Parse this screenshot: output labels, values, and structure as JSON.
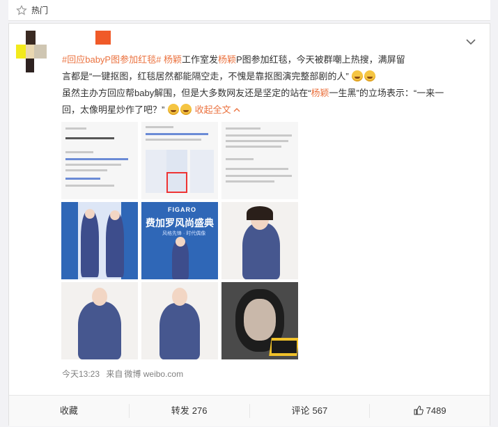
{
  "header": {
    "title": "热门",
    "icon": "star-icon"
  },
  "post": {
    "line1_prefix": "#",
    "line1_hashtag": "回应babyP图参加红毯",
    "line1_hashtag_end": "#",
    "line1_name": "杨颖",
    "line1_text_a": "工作室发",
    "line1_name2": "杨颖",
    "line1_text_b": "P图参加红毯，今天被群嘲上热搜，满屏留",
    "line2_text": "言都是“一键抠图，红毯居然都能隔空走，不愧是靠抠图演完整部剧的人”",
    "line3_text_a": "虽然主办方回应帮baby解围，但是大多数网友还是坚定的站在“",
    "line3_name": "杨颖",
    "line3_text_b": "一生黑”的立场表示：“一来一",
    "line4_text": "回，太像明星炒作了吧？”",
    "collapse": "收起全文",
    "collapse_icon": "chevron-up-icon"
  },
  "images": {
    "figaro_title": "FIGARO",
    "figaro_main": "费加罗风尚盛典",
    "figaro_sub": "风格先锋 · 时代偶像"
  },
  "meta": {
    "time": "今天13:23",
    "source_prefix": "来自",
    "source": "微博 weibo.com"
  },
  "actions": {
    "favorite": "收藏",
    "repost_label": "转发",
    "repost_count": "276",
    "comment_label": "评论",
    "comment_count": "567",
    "like_count": "7489"
  },
  "colors": {
    "accent": "#eb7340",
    "text": "#333333",
    "muted": "#808080"
  }
}
